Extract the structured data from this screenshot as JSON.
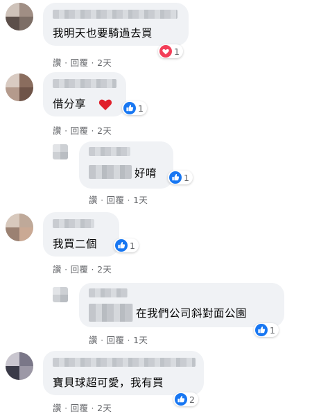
{
  "comments": [
    {
      "text": "我明天也要騎過去買",
      "reaction_icon": "love-icon",
      "reaction_count": "1",
      "time": "2天"
    },
    {
      "text": "借分享",
      "emoji": "red-heart-icon",
      "reaction_icon": "like-icon",
      "reaction_count": "1",
      "time": "2天"
    },
    {
      "text": "好唷",
      "reaction_icon": "like-icon",
      "reaction_count": "1",
      "time": "1天"
    },
    {
      "text": "我買二個",
      "reaction_icon": "like-icon",
      "reaction_count": "1",
      "time": "2天"
    },
    {
      "text": "在我們公司斜對面公園",
      "reaction_icon": "like-icon",
      "reaction_count": "1",
      "time": "1天"
    },
    {
      "text": "寶貝球超可愛，我有買",
      "reaction_icon": "like-icon",
      "reaction_count": "2",
      "time": "2天"
    }
  ],
  "actions": {
    "like": "讚",
    "reply": "回覆",
    "separator": "·"
  },
  "colors": {
    "like_blue": "#1877f2",
    "love_red": "#f33e58",
    "bubble": "#f0f2f5",
    "meta": "#65676b"
  }
}
